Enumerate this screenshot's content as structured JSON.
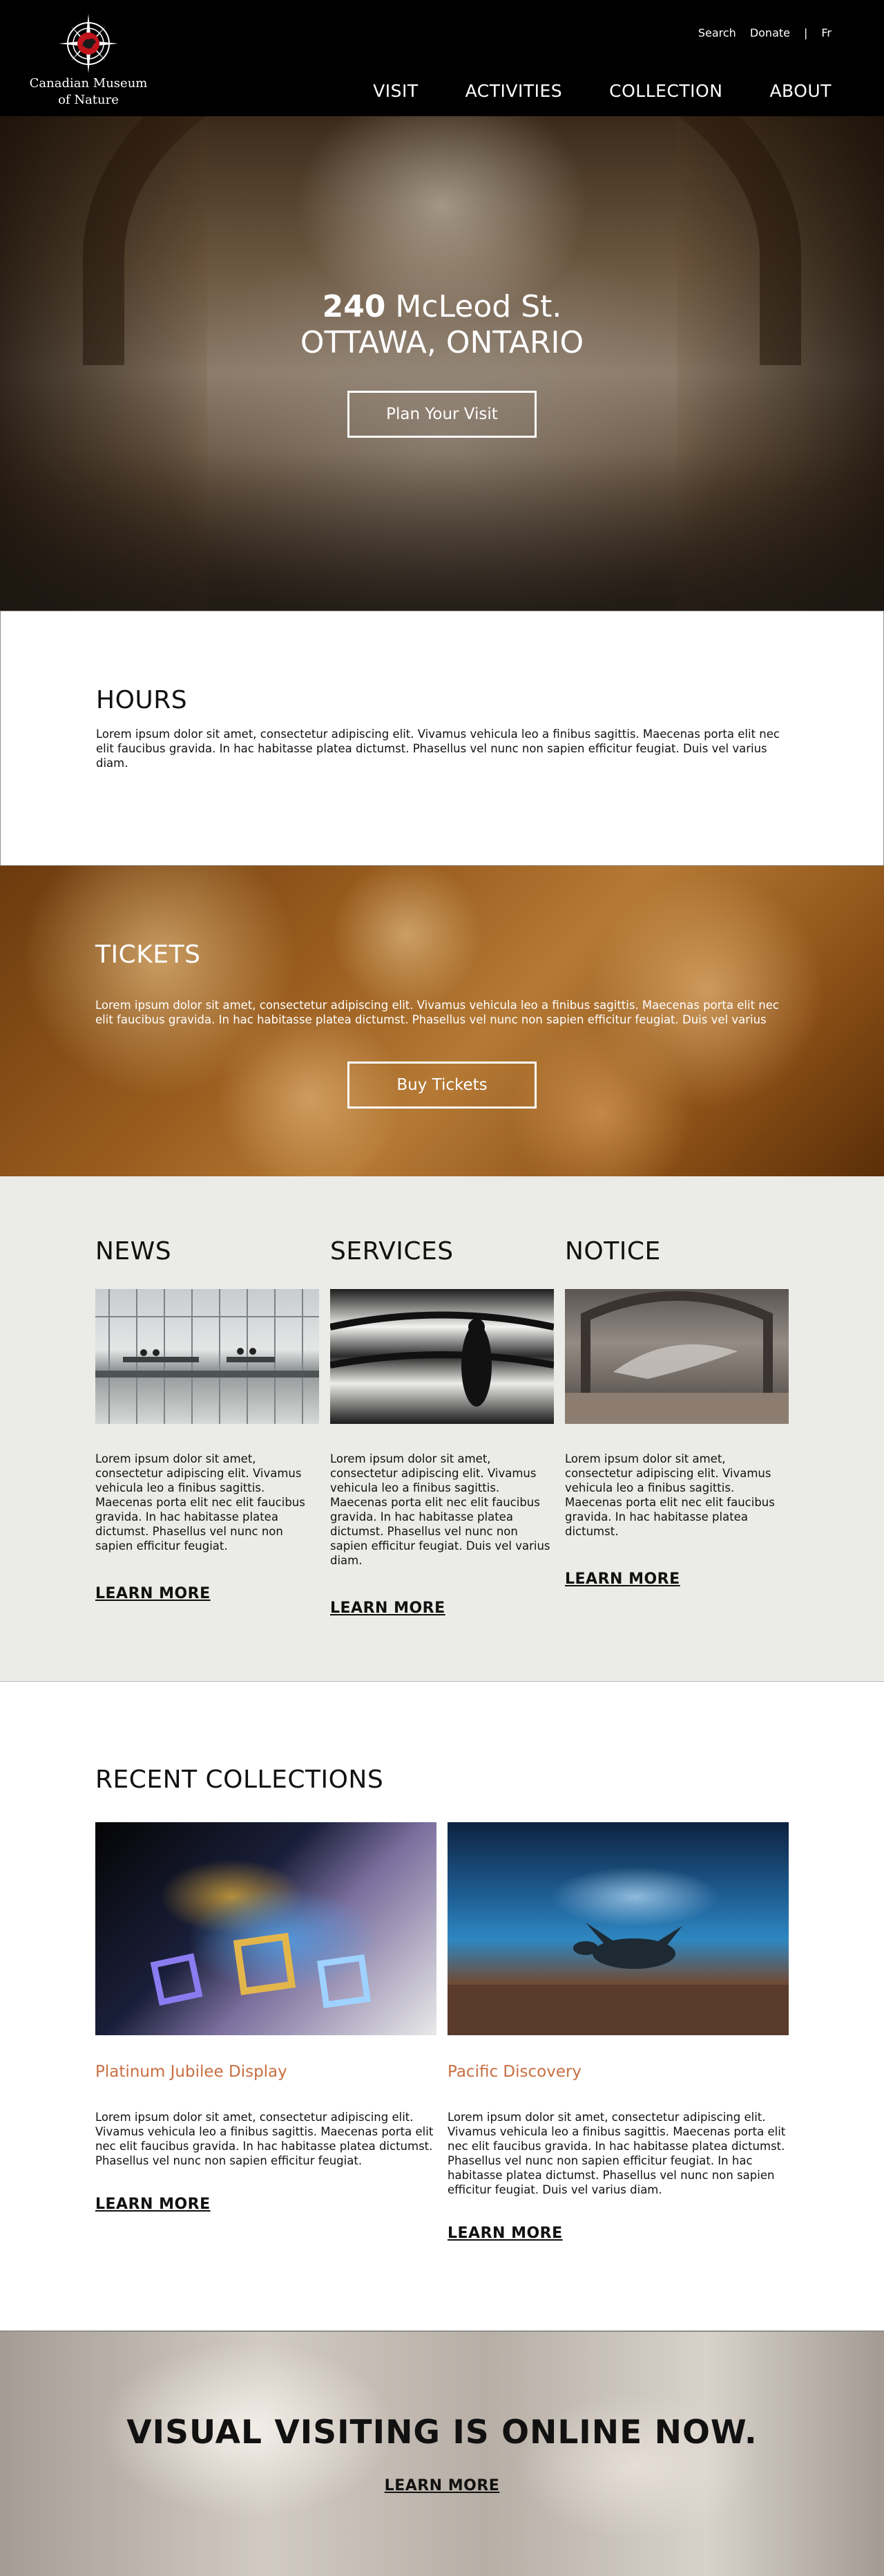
{
  "header": {
    "logo_line1": "Canadian Museum",
    "logo_line2": "of Nature",
    "util_nav": [
      "Search",
      "Donate",
      "|",
      "Fr"
    ],
    "main_nav": [
      "VISIT",
      "ACTIVITIES",
      "COLLECTION",
      "ABOUT"
    ]
  },
  "hero": {
    "address_number": "240",
    "address_street": " McLeod St.",
    "city": "OTTAWA, ONTARIO",
    "cta_label": "Plan Your Visit"
  },
  "hours": {
    "title": "HOURS",
    "text": "Lorem ipsum dolor sit amet, consectetur adipiscing elit. Vivamus vehicula leo a finibus sagittis. Maecenas porta elit nec elit faucibus gravida. In hac habitasse platea dictumst. Phasellus vel  nunc non sapien efficitur feugiat. Duis vel varius diam."
  },
  "tickets": {
    "title": "TICKETS",
    "text": "Lorem ipsum dolor sit amet, consectetur adipiscing elit. Vivamus vehicula leo a finibus sagittis. Maecenas porta elit nec elit faucibus gravida. In hac habitasse platea dictumst. Phasellus vel nunc non sapien efficitur feugiat. Duis vel varius",
    "cta_label": "Buy Tickets"
  },
  "columns": [
    {
      "title": "NEWS",
      "text": "Lorem ipsum dolor sit amet, consectetur adipiscing elit. Vivamus vehicula leo a finibus sagittis. Maecenas porta elit nec elit faucibus gravida. In hac habitasse platea dictumst. Phasellus vel nunc non sapien efficitur feugiat.",
      "link": "LEARN MORE"
    },
    {
      "title": "SERVICES",
      "text": "Lorem ipsum dolor sit amet, consectetur adipiscing elit. Vivamus vehicula leo a finibus sagittis. Maecenas porta elit nec elit faucibus gravida. In hac habitasse platea dictumst. Phasellus vel nunc non sapien efficitur feugiat. Duis vel varius diam.",
      "link": "LEARN MORE"
    },
    {
      "title": "NOTICE",
      "text": "Lorem ipsum dolor sit amet, consectetur adipiscing elit. Vivamus vehicula leo a finibus sagittis. Maecenas porta elit nec elit faucibus gravida. In hac habitasse platea dictumst.",
      "link": "LEARN MORE"
    }
  ],
  "recent": {
    "title": "RECENT COLLECTIONS",
    "cards": [
      {
        "title": "Platinum Jubilee Display",
        "text": "Lorem ipsum dolor sit amet, consectetur adipiscing elit. Vivamus vehicula leo a finibus sagittis. Maecenas porta elit nec elit faucibus gravida. In hac habitasse platea dictumst. Phasellus vel nunc non sapien efficitur feugiat.",
        "link": "LEARN MORE"
      },
      {
        "title": "Pacific Discovery",
        "text": "Lorem ipsum dolor sit amet, consectetur adipiscing elit. Vivamus vehicula leo a finibus sagittis. Maecenas porta elit nec elit faucibus gravida. In hac habitasse platea dictumst. Phasellus vel nunc non sapien efficitur feugiat. In hac habitasse platea dictumst. Phasellus vel nunc non sapien efficitur feugiat. Duis vel varius diam.",
        "link": "LEARN MORE"
      }
    ]
  },
  "visual": {
    "title": "VISUAL VISITING IS ONLINE NOW.",
    "link": "LEARN MORE"
  },
  "colors": {
    "header_bg": "#000000",
    "accent_title": "#c86f43",
    "section_gray": "#ebebe8"
  },
  "icons": [
    "compass-logo-icon"
  ]
}
